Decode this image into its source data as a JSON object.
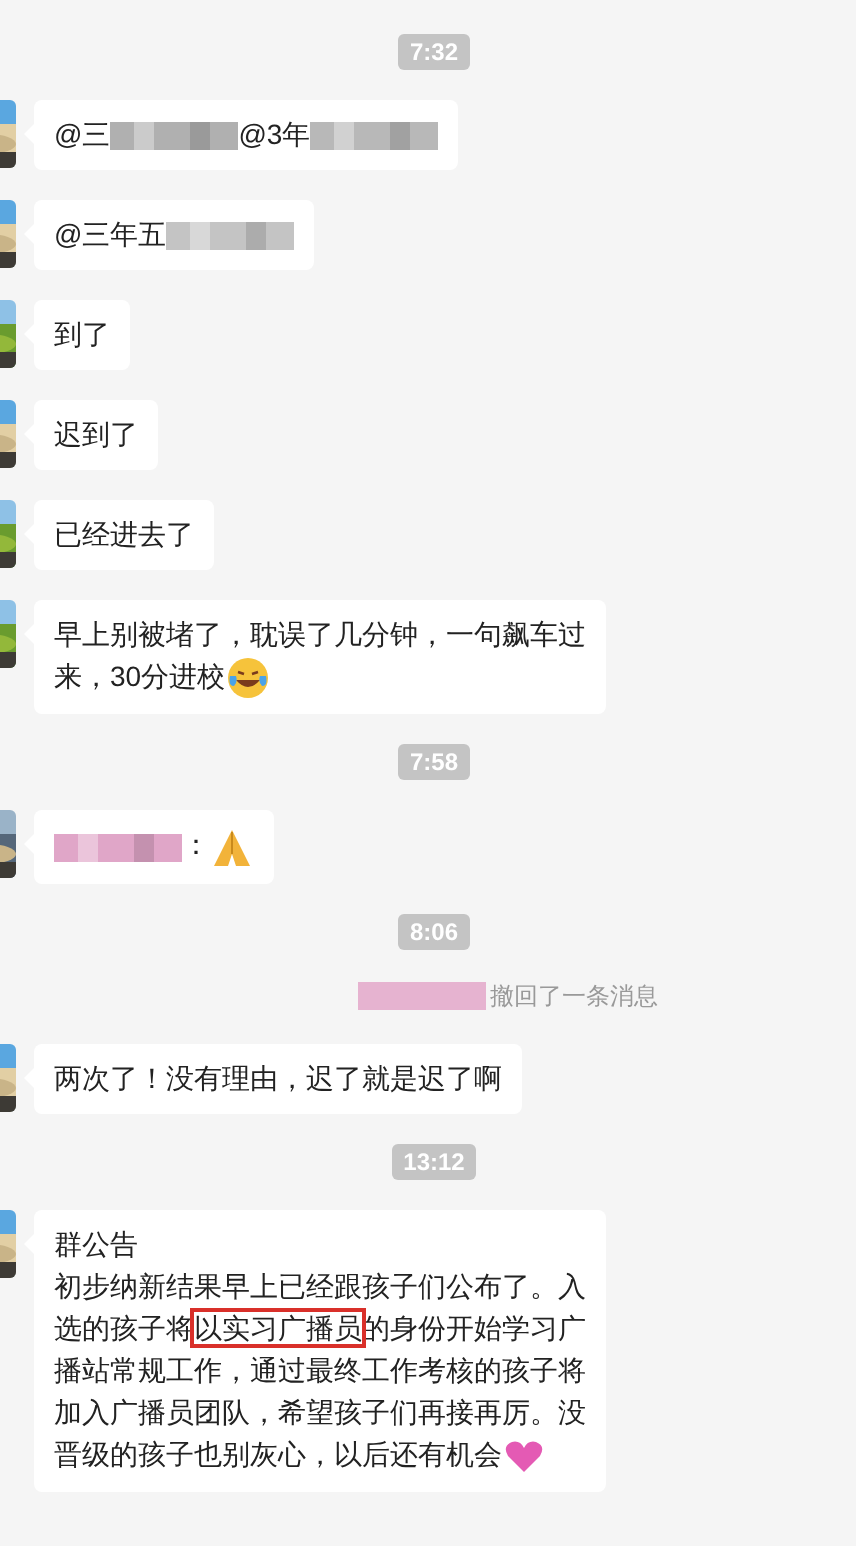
{
  "messages": [
    {
      "kind": "time",
      "text": "7:32"
    },
    {
      "kind": "bubble",
      "parts": [
        {
          "kind": "text",
          "text": "@三"
        },
        {
          "kind": "blur",
          "color": "#b0b0b0"
        },
        {
          "kind": "text",
          "text": "@3年"
        },
        {
          "kind": "blur",
          "color": "#b8b8b8"
        }
      ]
    },
    {
      "kind": "bubble",
      "parts": [
        {
          "kind": "text",
          "text": "@三年五"
        },
        {
          "kind": "blur",
          "color": "#c4c4c4"
        }
      ]
    },
    {
      "kind": "bubble",
      "parts": [
        {
          "kind": "text",
          "text": "到了"
        }
      ]
    },
    {
      "kind": "bubble",
      "parts": [
        {
          "kind": "text",
          "text": "迟到了"
        }
      ]
    },
    {
      "kind": "bubble",
      "parts": [
        {
          "kind": "text",
          "text": "已经进去了"
        }
      ]
    },
    {
      "kind": "bubble",
      "parts": [
        {
          "kind": "line",
          "text": "早上别被堵了，耽误了几分钟，一句飙车过"
        },
        {
          "kind": "text",
          "text": "来，30分进校"
        },
        {
          "kind": "laughing"
        }
      ]
    },
    {
      "kind": "time",
      "text": "7:58"
    },
    {
      "kind": "bubble",
      "parts": [
        {
          "kind": "blur",
          "color": "#e0a6c8"
        },
        {
          "kind": "text",
          "text": "："
        },
        {
          "kind": "hands"
        }
      ]
    },
    {
      "kind": "time",
      "text": "8:06"
    },
    {
      "kind": "recall",
      "color": "#e6b3d0",
      "text": "撤回了一条消息"
    },
    {
      "kind": "bubble",
      "parts": [
        {
          "kind": "text",
          "text": "两次了！没有理由，迟了就是迟了啊"
        }
      ]
    },
    {
      "kind": "time",
      "text": "13:12"
    },
    {
      "kind": "announcement",
      "title": "群公告",
      "before": "初步纳新结果早上已经跟孩子们公布了。入选的孩子将",
      "highlighted": "以实习广播员",
      "after": "的身份开始学习广播站常规工作，通过最终工作考核的孩子将加入广播员团队，希望孩子们再接再厉。没晋级的孩子也别灰心，以后还有机会"
    }
  ]
}
